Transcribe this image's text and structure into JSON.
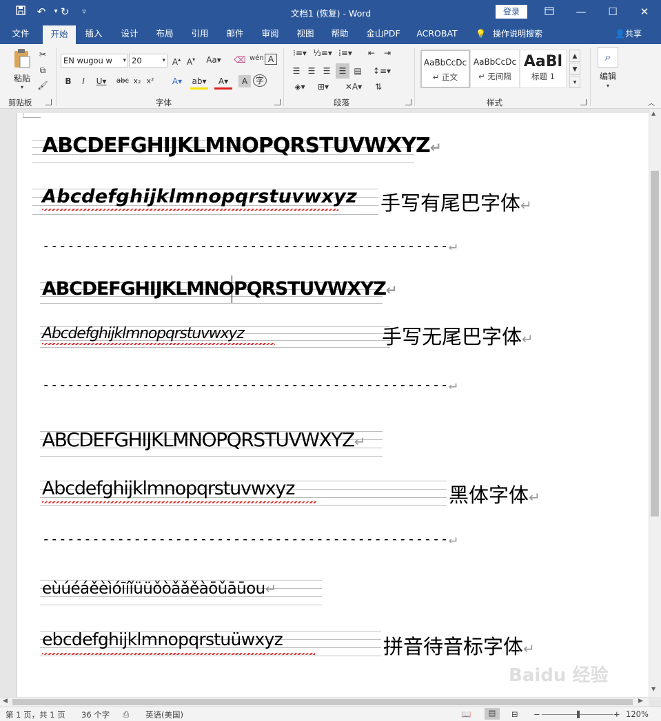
{
  "titlebar": {
    "title": "文档1 (恢复) - Word",
    "signin": "登录",
    "save_icon": "save-icon",
    "undo_icon": "undo-icon",
    "redo_icon": "redo-icon",
    "customize_icon": "customize-icon"
  },
  "tabs": [
    "文件",
    "开始",
    "插入",
    "设计",
    "布局",
    "引用",
    "邮件",
    "审阅",
    "视图",
    "帮助",
    "金山PDF",
    "ACROBAT"
  ],
  "active_tab": "开始",
  "tell_me": "操作说明搜索",
  "share": "共享",
  "ribbon": {
    "clipboard": {
      "label": "剪贴板",
      "paste": "粘贴"
    },
    "font": {
      "label": "字体",
      "name": "EN wugou w",
      "size": "20"
    },
    "paragraph": {
      "label": "段落"
    },
    "styles": {
      "label": "样式",
      "items": [
        {
          "sample": "AaBbCcDc",
          "name": "↵ 正文"
        },
        {
          "sample": "AaBbCcDc",
          "name": "↵ 无间隔"
        },
        {
          "sample": "AaBl",
          "name": "标题 1"
        }
      ]
    },
    "editing": {
      "label": "编辑"
    }
  },
  "document": {
    "lines": [
      {
        "text": "ABCDEFGHIJKLMNOPQRSTUVWXYZ"
      },
      {
        "text": "Abcdefghijklmnopqrstuvwxyz",
        "caption": "手写有尾巴字体"
      },
      {
        "text": "-------------------------------------------------"
      },
      {
        "text": "ABCDEFGHIJKLMNOPQRSTUVWXYZ"
      },
      {
        "text": "Abcdefghijklmnopqrstuvwxyz",
        "caption": "手写无尾巴字体"
      },
      {
        "text": "-------------------------------------------------"
      },
      {
        "text": "ABCDEFGHIJKLMNOPQRSTUVWXYZ"
      },
      {
        "text": "Abcdefghijklmnopqrstuvwxyz",
        "caption": "黑体字体"
      },
      {
        "text": "-------------------------------------------------"
      },
      {
        "text": "eùúéáěèìóīíǐüüǒòǎǎěàōǔāūou"
      },
      {
        "text": "ebcdefghijklmnopqrstuüwxyz",
        "caption": "拼音待音标字体"
      }
    ],
    "para_mark": "↵"
  },
  "status": {
    "page": "第 1 页，共 1 页",
    "words": "36 个字",
    "language": "英语(美国)",
    "zoom": "120%"
  },
  "watermark": "Baidu 经验"
}
